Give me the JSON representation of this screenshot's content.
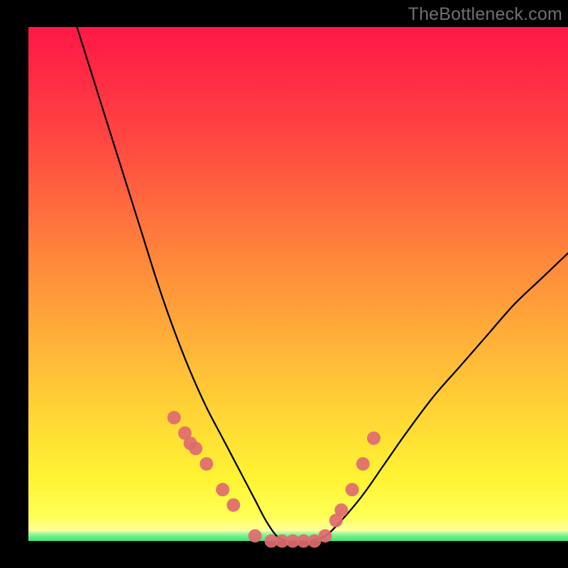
{
  "watermark": "TheBottleneck.com",
  "chart_data": {
    "type": "line",
    "title": "",
    "xlabel": "",
    "ylabel": "",
    "xlim": [
      0,
      100
    ],
    "ylim": [
      0,
      100
    ],
    "series": [
      {
        "name": "bottleneck-curve",
        "x": [
          9,
          12,
          15,
          18,
          21,
          24,
          27,
          30,
          33,
          36,
          38,
          40,
          42,
          44,
          46,
          48,
          50,
          52,
          55,
          58,
          62,
          66,
          70,
          75,
          80,
          85,
          90,
          95,
          100
        ],
        "values": [
          100,
          90,
          80,
          70,
          60,
          50,
          41,
          33,
          26,
          20,
          16,
          12,
          8,
          4,
          1,
          0,
          0,
          0,
          1,
          4,
          9,
          15,
          21,
          28,
          34,
          40,
          46,
          51,
          56
        ]
      }
    ],
    "markers": {
      "name": "highlighted-points",
      "color": "#e06a70",
      "x": [
        27,
        29,
        30,
        31,
        33,
        36,
        38,
        42,
        45,
        47,
        49,
        51,
        53,
        55,
        57,
        58,
        60,
        62,
        64
      ],
      "values": [
        24,
        21,
        19,
        18,
        15,
        10,
        7,
        1,
        0,
        0,
        0,
        0,
        0,
        1,
        4,
        6,
        10,
        15,
        20
      ]
    },
    "gradient_bands": [
      {
        "name": "red-yellow",
        "from_y": 100,
        "to_y": 4
      },
      {
        "name": "green",
        "from_y": 2,
        "to_y": 0
      }
    ]
  }
}
